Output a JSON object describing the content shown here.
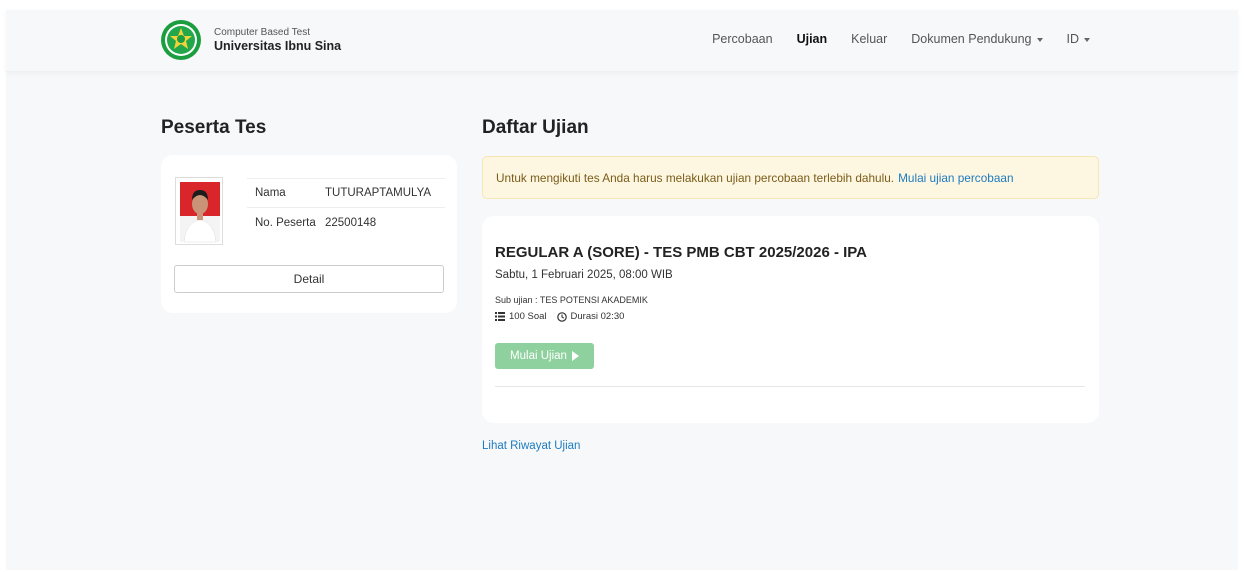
{
  "brand": {
    "subtitle": "Computer Based Test",
    "title": "Universitas Ibnu Sina"
  },
  "nav": {
    "items": [
      {
        "label": "Percobaan"
      },
      {
        "label": "Ujian"
      },
      {
        "label": "Keluar"
      },
      {
        "label": "Dokumen Pendukung"
      },
      {
        "label": "ID"
      }
    ]
  },
  "peserta": {
    "section_title": "Peserta Tes",
    "name_label": "Nama",
    "name_value": "TUTURAPTAMULYA",
    "number_label": "No. Peserta",
    "number_value": "22500148",
    "detail_button": "Detail"
  },
  "daftar": {
    "section_title": "Daftar Ujian",
    "alert_text": "Untuk mengikuti tes Anda harus melakukan ujian percobaan terlebih dahulu.",
    "alert_link": "Mulai ujian percobaan",
    "exam": {
      "title": "REGULAR A (SORE) - TES PMB CBT 2025/2026 - IPA",
      "date": "Sabtu, 1 Februari 2025, 08:00 WIB",
      "sub": "Sub ujian : TES POTENSI AKADEMIK",
      "questions": "100 Soal",
      "duration": "Durasi 02:30",
      "start_button": "Mulai Ujian"
    },
    "history_link": "Lihat Riwayat Ujian"
  },
  "colors": {
    "accent_link": "#1e7bc0",
    "start_button_disabled": "#8fd19e",
    "alert_bg": "#fdf6e0",
    "logo_green": "#1b9e3e"
  },
  "icons": [
    "university-logo",
    "caret-down-icon",
    "list-icon",
    "clock-icon",
    "play-icon"
  ]
}
